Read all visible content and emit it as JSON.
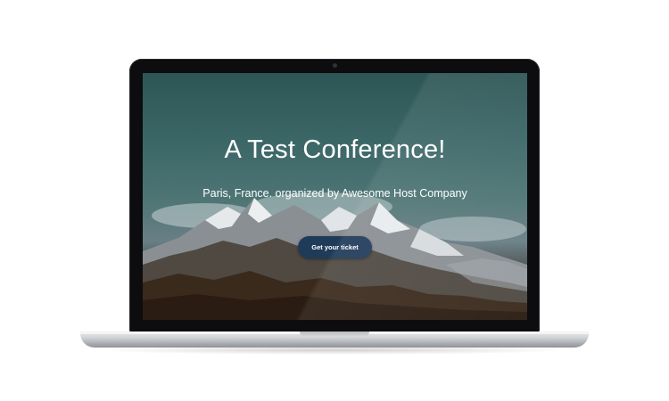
{
  "hero": {
    "title": "A Test Conference!",
    "subtitle": "Paris, France. organized by Awesome Host Company",
    "cta_label": "Get your ticket"
  },
  "colors": {
    "cta_background": "#1f3b5a",
    "sky_top": "#2d5555",
    "text": "#ffffff"
  }
}
